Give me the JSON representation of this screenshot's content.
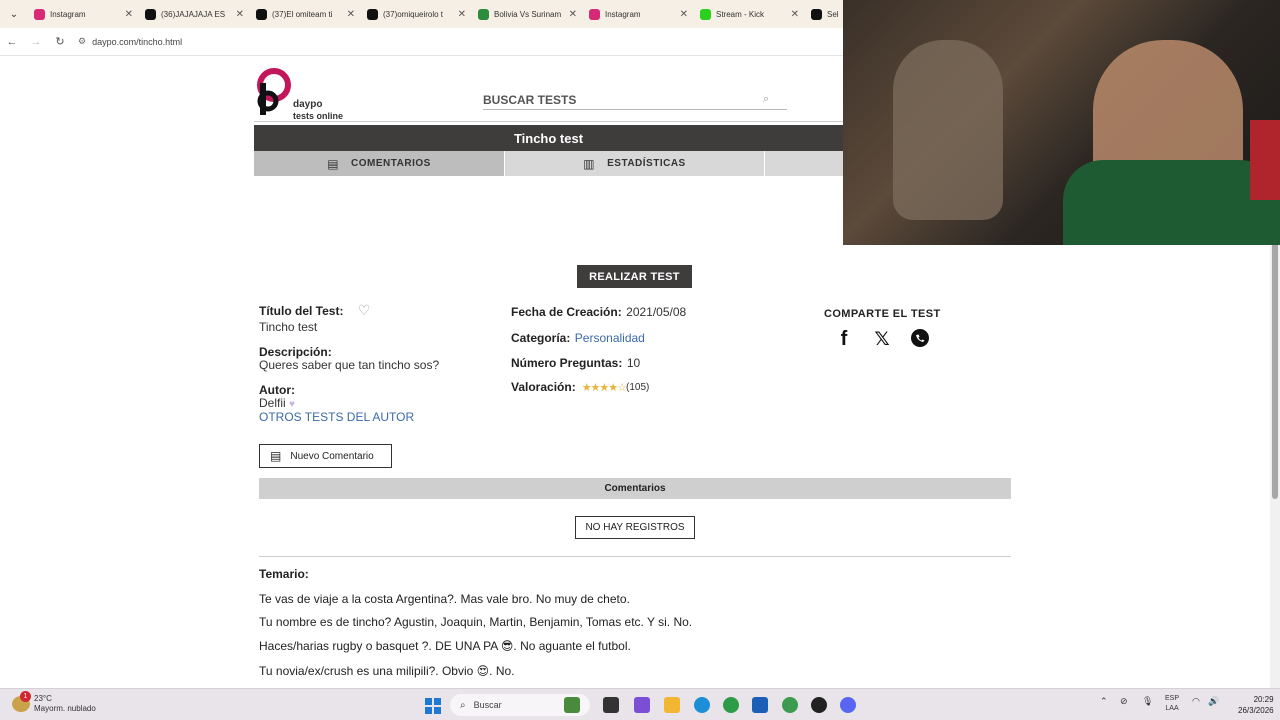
{
  "browser": {
    "tabs": [
      {
        "label": "Instagram",
        "color": "#d62976"
      },
      {
        "label": "(36)JAJAJAJA ES",
        "color": "#111111"
      },
      {
        "label": "(37)El omiteam ti",
        "color": "#111111"
      },
      {
        "label": "(37)omiqueirolo t",
        "color": "#111111"
      },
      {
        "label": "Bolivia Vs Surinam",
        "color": "#2e8b3c"
      },
      {
        "label": "Instagram",
        "color": "#d62976"
      },
      {
        "label": "Stream - Kick",
        "color": "#2bd01e"
      },
      {
        "label": "Selec",
        "color": "#111111"
      }
    ],
    "url": "daypo.com/tincho.html"
  },
  "site": {
    "logo_line1": "daypo",
    "logo_line2": "tests online",
    "search_placeholder": "BUSCAR TESTS",
    "test_title": "Tincho test",
    "tabs": {
      "comentarios": "COMENTARIOS",
      "estadisticas": "ESTADÍSTICAS"
    }
  },
  "test": {
    "realizar_label": "REALIZAR TEST",
    "titulo_label": "Título del Test:",
    "titulo_value": "Tincho test",
    "descripcion_label": "Descripción:",
    "descripcion_value": "Queres saber que tan tincho sos?",
    "autor_label": "Autor:",
    "autor_value": "Delfii",
    "otros_tests": "OTROS TESTS DEL AUTOR",
    "fecha_label": "Fecha de Creación:",
    "fecha_value": "2021/05/08",
    "categoria_label": "Categoría:",
    "categoria_value": "Personalidad",
    "preguntas_label": "Número Preguntas:",
    "preguntas_value": "10",
    "valoracion_label": "Valoración:",
    "valoracion_stars": 3.5,
    "valoracion_count": "(105)",
    "comparte_label": "COMPARTE EL TEST"
  },
  "comments": {
    "nuevo_label": "Nuevo Comentario",
    "header": "Comentarios",
    "empty_label": "NO HAY REGISTROS"
  },
  "temario": {
    "label": "Temario:",
    "questions": [
      "Te vas de viaje a la costa Argentina?. Mas vale bro. No muy de cheto.",
      "Tu nombre es de tincho? Agustin, Joaquin, Martin, Benjamin, Tomas etc. Y si. No.",
      "Haces/harias rugby o basquet ?. DE UNA PA 😎. No aguante el futbol.",
      "Tu novia/ex/crush es una milipili?. Obvio 😍. No."
    ]
  },
  "taskbar": {
    "temp": "23°C",
    "weather": "Mayorm. nublado",
    "weather_badge": "1",
    "search_label": "Buscar",
    "lang1": "ESP",
    "lang2": "LAA",
    "time": "20:29",
    "date": "26/3/2026"
  }
}
